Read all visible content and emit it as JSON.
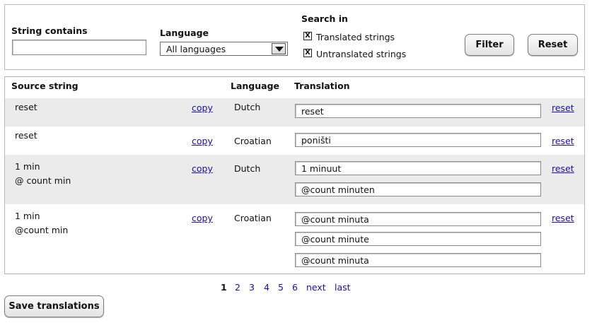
{
  "filter": {
    "string_label": "String contains",
    "string_value": "",
    "language_label": "Language",
    "language_selected": "All languages",
    "search_in_label": "Search in",
    "checks": [
      {
        "label": "Translated strings",
        "checked": true,
        "mark": "X"
      },
      {
        "label": "Untranslated strings",
        "checked": true,
        "mark": "X"
      }
    ],
    "filter_button": "Filter",
    "reset_button": "Reset"
  },
  "table": {
    "headers": {
      "source": "Source string",
      "language": "Language",
      "translation": "Translation"
    },
    "copy_label": "copy",
    "reset_label": "reset",
    "rows": [
      {
        "source": [
          "reset"
        ],
        "language": "Dutch",
        "translations": [
          "reset"
        ]
      },
      {
        "source": [
          "reset"
        ],
        "language": "Croatian",
        "translations": [
          "poništi"
        ]
      },
      {
        "source": [
          "1 min",
          "@ count min"
        ],
        "language": "Dutch",
        "translations": [
          "1 minuut",
          "@count minuten"
        ]
      },
      {
        "source": [
          "1 min",
          "@count min"
        ],
        "language": "Croatian",
        "translations": [
          "@count minuta",
          "@count minute",
          "@count minuta"
        ]
      }
    ]
  },
  "pager": {
    "current": "1",
    "pages": [
      "2",
      "3",
      "4",
      "5",
      "6"
    ],
    "next": "next",
    "last": "last"
  },
  "save_button": "Save translations"
}
